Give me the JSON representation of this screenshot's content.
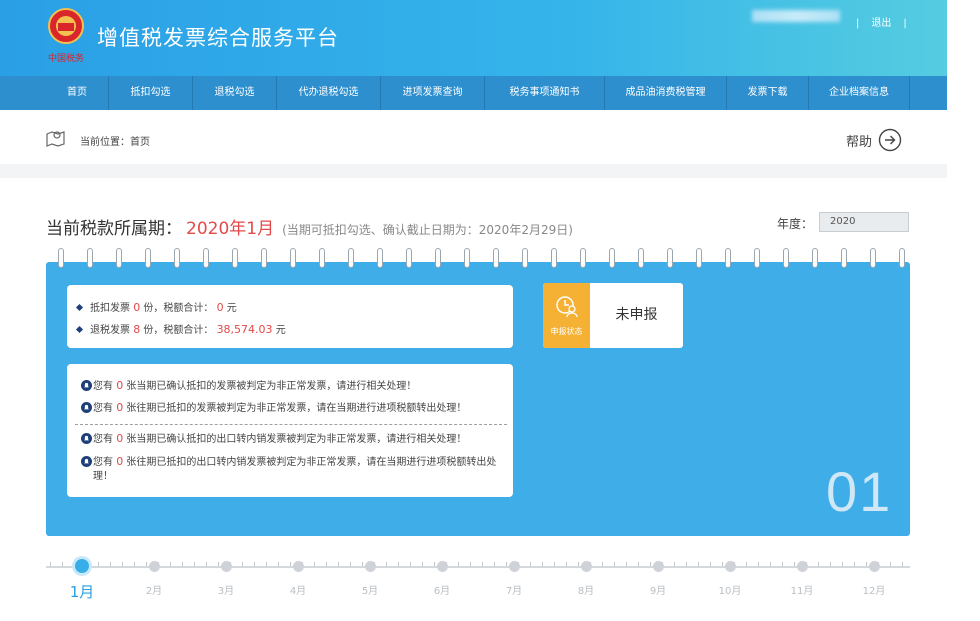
{
  "header": {
    "emblem_text": "中国税务",
    "brand_title": "增值税发票综合服务平台",
    "user_links": [
      "|",
      "退出",
      "|"
    ]
  },
  "nav": {
    "items": [
      "首页",
      "抵扣勾选",
      "退税勾选",
      "代办退税勾选",
      "进项发票查询",
      "税务事项通知书",
      "成品油消费税管理",
      "发票下载",
      "企业档案信息"
    ]
  },
  "breadcrumb": {
    "label": "当前位置：首页",
    "help": "帮助"
  },
  "period": {
    "label": "当前税款所属期：",
    "value": "2020年1月",
    "note": "(当期可抵扣勾选、确认截止日期为：2020年2月29日)",
    "year_label": "年度：",
    "year_value": "2020"
  },
  "summary": {
    "deduct": {
      "pre": "抵扣发票",
      "count": "0",
      "mid": "份，税额合计：",
      "amount": "0",
      "unit": "元"
    },
    "refund": {
      "pre": "退税发票",
      "count": "8",
      "mid": "份，税额合计：",
      "amount": "38,574.03",
      "unit": "元"
    }
  },
  "alerts": [
    {
      "pre": "您有",
      "count": "0",
      "text": "张当期已确认抵扣的发票被判定为非正常发票，请进行相关处理！"
    },
    {
      "pre": "您有",
      "count": "0",
      "text": "张往期已抵扣的发票被判定为非正常发票，请在当期进行进项税额转出处理！"
    },
    {
      "pre": "您有",
      "count": "0",
      "text": "张当期已确认抵扣的出口转内销发票被判定为非正常发票，请进行相关处理！"
    },
    {
      "pre": "您有",
      "count": "0",
      "text": "张往期已抵扣的出口转内销发票被判定为非正常发票，请在当期进行进项税额转出处理！"
    }
  ],
  "status": {
    "caption": "申报状态",
    "value": "未申报"
  },
  "month_number": "01",
  "timeline": {
    "months": [
      "1月",
      "2月",
      "3月",
      "4月",
      "5月",
      "6月",
      "7月",
      "8月",
      "9月",
      "10月",
      "11月",
      "12月"
    ],
    "active_index": 0
  },
  "colors": {
    "header": "#35b4ea",
    "nav": "#2e8fcf",
    "panel": "#3fade8",
    "status_accent": "#f5b134",
    "highlight_red": "#e24a4a"
  }
}
